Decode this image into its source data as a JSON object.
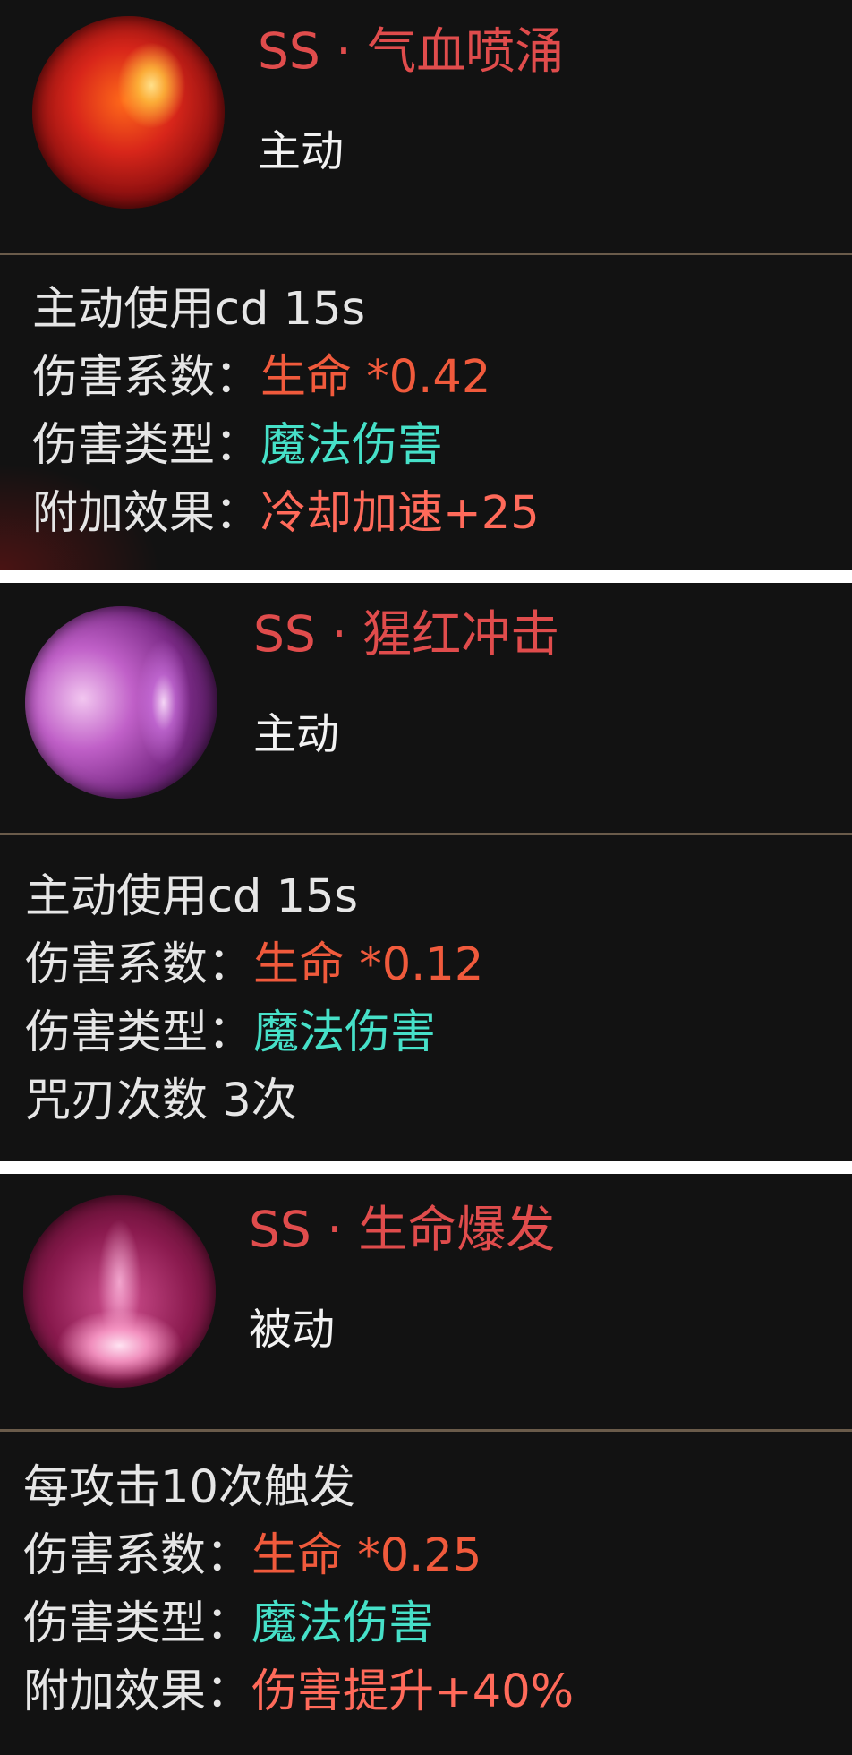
{
  "cards": [
    {
      "icon": "blood-surge-skill-icon",
      "title": "SS · 气血喷涌",
      "type": "主动",
      "cd": "主动使用cd 15s",
      "coef_label": "伤害系数：",
      "coef_value": "生命 *0.42",
      "dmg_label": "伤害类型：",
      "dmg_value": "魔法伤害",
      "extra_label": "附加效果：",
      "extra_value": "冷却加速+25"
    },
    {
      "icon": "scarlet-strike-skill-icon",
      "title": "SS · 猩红冲击",
      "type": "主动",
      "cd": "主动使用cd 15s",
      "coef_label": "伤害系数：",
      "coef_value": "生命 *0.12",
      "dmg_label": "伤害类型：",
      "dmg_value": "魔法伤害",
      "extra_text": "咒刃次数 3次"
    },
    {
      "icon": "life-burst-skill-icon",
      "title": "SS · 生命爆发",
      "type": "被动",
      "trigger": "每攻击10次触发",
      "coef_label": "伤害系数：",
      "coef_value": "生命 *0.25",
      "dmg_label": "伤害类型：",
      "dmg_value": "魔法伤害",
      "extra_label": "附加效果：",
      "extra_value": "伤害提升+40%"
    }
  ],
  "colors": {
    "title": "#e04c4c",
    "coefficient": "#f05a3c",
    "damage_type": "#46e0c8",
    "extra_effect": "#ff6a5a",
    "panel_bg": "#121212",
    "divider": "#6a5b4a"
  }
}
